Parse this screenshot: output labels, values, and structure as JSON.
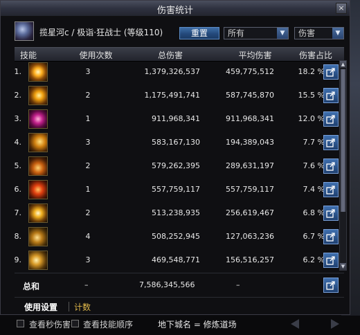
{
  "window": {
    "title": "伤害统计",
    "close_label": "×"
  },
  "header": {
    "player_name": "揽星河c / 极诣·狂战士 (等级110)",
    "reset_label": "重置",
    "filter_value": "所有",
    "type_value": "伤害"
  },
  "columns": {
    "skill": "技能",
    "uses": "使用次数",
    "total": "总伤害",
    "avg": "平均伤害",
    "pct": "伤害占比"
  },
  "rows": [
    {
      "idx": "1.",
      "icon": "skill-icon-burst",
      "uses": "3",
      "total": "1,379,326,537",
      "avg": "459,775,512",
      "pct": "18.2  %"
    },
    {
      "idx": "2.",
      "icon": "skill-icon-slash",
      "uses": "2",
      "total": "1,175,491,741",
      "avg": "587,745,870",
      "pct": "15.5  %"
    },
    {
      "idx": "3.",
      "icon": "skill-icon-blood",
      "uses": "1",
      "total": "911,968,341",
      "avg": "911,968,341",
      "pct": "12.0  %"
    },
    {
      "idx": "4.",
      "icon": "skill-icon-wave",
      "uses": "3",
      "total": "583,167,130",
      "avg": "194,389,043",
      "pct": "7.7  %"
    },
    {
      "idx": "5.",
      "icon": "skill-icon-rage",
      "uses": "2",
      "total": "579,262,395",
      "avg": "289,631,197",
      "pct": "7.6  %"
    },
    {
      "idx": "6.",
      "icon": "skill-icon-flame",
      "uses": "1",
      "total": "557,759,117",
      "avg": "557,759,117",
      "pct": "7.4  %"
    },
    {
      "idx": "7.",
      "icon": "skill-icon-nova",
      "uses": "2",
      "total": "513,238,935",
      "avg": "256,619,467",
      "pct": "6.8  %"
    },
    {
      "idx": "8.",
      "icon": "skill-icon-strike",
      "uses": "4",
      "total": "508,252,945",
      "avg": "127,063,236",
      "pct": "6.7  %"
    },
    {
      "idx": "9.",
      "icon": "skill-icon-crescent",
      "uses": "3",
      "total": "469,548,771",
      "avg": "156,516,257",
      "pct": "6.2  %"
    }
  ],
  "total": {
    "label": "总和",
    "uses": "–",
    "total": "7,586,345,566",
    "avg": "–"
  },
  "tabs": {
    "settings": "使用设置",
    "count": "计数"
  },
  "footer": {
    "cb1_label": "查看秒伤害",
    "cb2_label": "查看技能顺序",
    "dungeon_label": "地下城名 = 修炼道场"
  },
  "colors": {
    "accent_blue": "#2f5f9e",
    "tab_gold": "#e0b84a"
  }
}
